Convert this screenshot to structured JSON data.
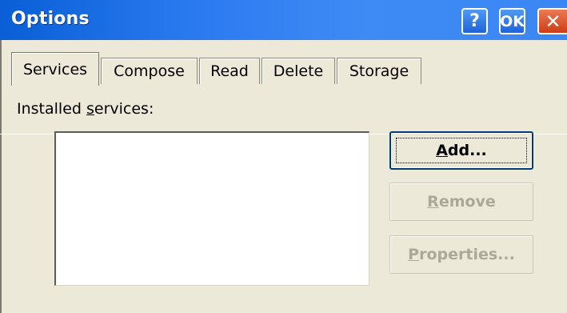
{
  "window": {
    "title": "Options"
  },
  "title_buttons": {
    "help": "?",
    "ok": "OK",
    "close": "✕"
  },
  "tabs": [
    {
      "label": "Services",
      "active": true
    },
    {
      "label": "Compose",
      "active": false
    },
    {
      "label": "Read",
      "active": false
    },
    {
      "label": "Delete",
      "active": false
    },
    {
      "label": "Storage",
      "active": false
    }
  ],
  "services": {
    "label_pre": "Installed ",
    "label_u": "s",
    "label_post": "ervices:",
    "items": []
  },
  "buttons": {
    "add": {
      "u": "A",
      "rest": "dd...",
      "enabled": true
    },
    "remove": {
      "u": "R",
      "rest": "emove",
      "enabled": false
    },
    "properties": {
      "u": "P",
      "rest": "roperties...",
      "enabled": false
    }
  },
  "colors": {
    "titlebar": "#2b7af0",
    "dialog_bg": "#ece9d8",
    "close_button": "#cf3d15",
    "disabled_text": "#aca899"
  }
}
